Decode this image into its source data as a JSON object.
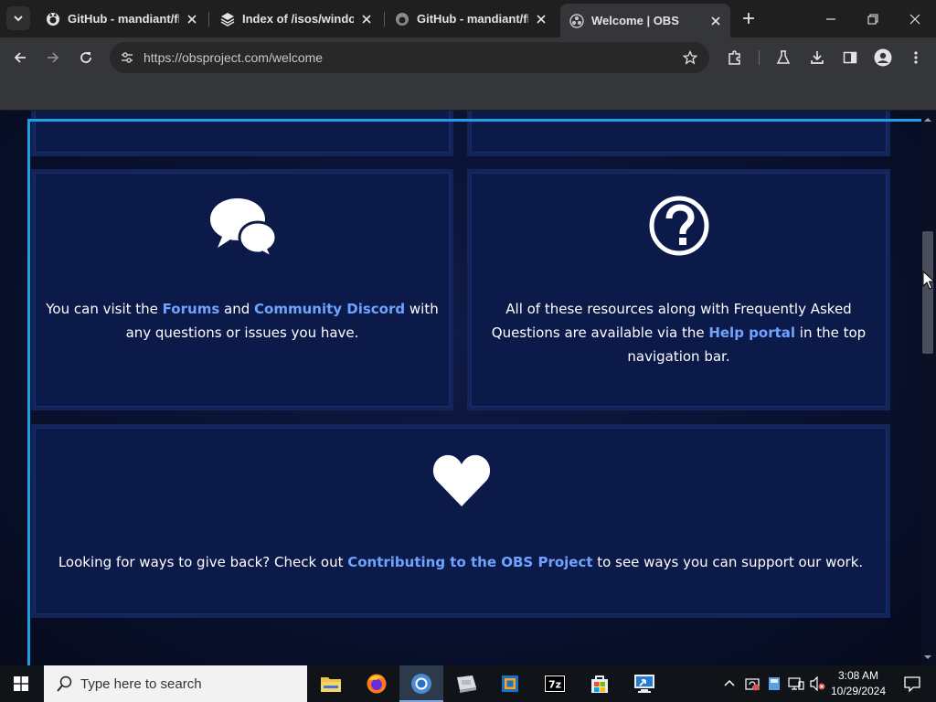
{
  "browser": {
    "tabs": [
      {
        "title": "GitHub - mandiant/fla",
        "favicon": "github-icon",
        "active": false
      },
      {
        "title": "Index of /isos/window",
        "favicon": "stack-icon",
        "active": false
      },
      {
        "title": "GitHub - mandiant/fla",
        "favicon": "github-icon",
        "active": false
      },
      {
        "title": "Welcome | OBS",
        "favicon": "obs-icon",
        "active": true
      }
    ],
    "url": "https://obsproject.com/welcome"
  },
  "page": {
    "forums_card": {
      "icon": "chat-bubbles-icon",
      "text_before": "You can visit the ",
      "link1": "Forums",
      "text_mid": " and ",
      "link2": "Community Discord",
      "text_after": " with any questions or issues you have."
    },
    "help_card": {
      "icon": "question-circle-icon",
      "text_before": "All of these resources along with Frequently Asked Questions are available via the ",
      "link": "Help portal",
      "text_after": " in the top navigation bar."
    },
    "contribute_card": {
      "icon": "heart-icon",
      "text_before": "Looking for ways to give back? Check out ",
      "link": "Contributing to the OBS Project",
      "text_after": " to see ways you can support our work."
    }
  },
  "taskbar": {
    "search_placeholder": "Type here to search",
    "apps": [
      "file-explorer-icon",
      "firefox-icon",
      "chrome-icon",
      "network-drive-icon",
      "virtualbox-icon",
      "7zip-icon",
      "store-icon",
      "remote-desktop-icon"
    ],
    "time": "3:08 AM",
    "date": "10/29/2024"
  },
  "colors": {
    "link": "#6fa3ff",
    "card_bg": "#0c1a4a",
    "focus_ring": "#1ea0e6"
  }
}
